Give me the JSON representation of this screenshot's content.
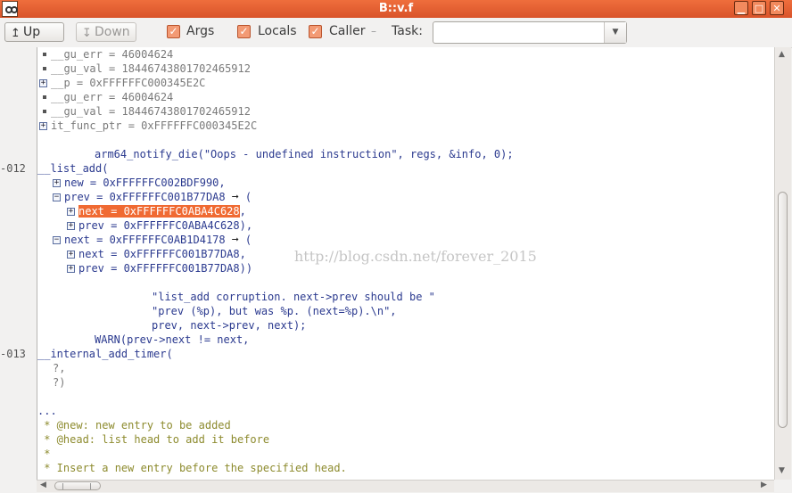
{
  "window": {
    "title": "B::v.f"
  },
  "toolbar": {
    "up_label": "Up",
    "down_label": "Down",
    "args_label": "Args",
    "locals_label": "Locals",
    "caller_label": "Caller",
    "task_label": "Task:",
    "task_value": ""
  },
  "gutter": {
    "ln_012": "-012",
    "ln_013": "-013"
  },
  "code": {
    "l01": "__gu_err = 46004624",
    "l02": "__gu_val = 18446743801702465912",
    "l03": "__p = 0xFFFFFFC000345E2C",
    "l04": "__gu_err = 46004624",
    "l05": "__gu_val = 18446743801702465912",
    "l06": "it_func_ptr = 0xFFFFFFC000345E2C",
    "l08": "arm64_notify_die(\"Oops - undefined instruction\", regs, &info, 0);",
    "l09": "__list_add(",
    "l10": "new = 0xFFFFFFC002BDF990,",
    "l11a": "prev = 0xFFFFFFC001B77DA8",
    "l11b": " (",
    "l12a": "next = 0xFFFFFFC0ABA4C628",
    "l12b": ",",
    "l13": "prev = 0xFFFFFFC0ABA4C628),",
    "l14a": "next = 0xFFFFFFC0AB1D4178",
    "l14b": " (",
    "l15": "next = 0xFFFFFFC001B77DA8,",
    "l16": "prev = 0xFFFFFFC001B77DA8))",
    "l18": "\"list_add corruption. next->prev should be \"",
    "l19": "\"prev (%p), but was %p. (next=%p).\\n\",",
    "l20": "prev, next->prev, next);",
    "l21": "WARN(prev->next != next,",
    "l22": "__internal_add_timer(",
    "l23": "?,",
    "l24": "?)",
    "l26": "...",
    "l27": " * @new: new entry to be added",
    "l28": " * @head: list head to add it before",
    "l29": " *",
    "l30": " * Insert a new entry before the specified head."
  },
  "watermark": "http://blog.csdn.net/forever_2015"
}
